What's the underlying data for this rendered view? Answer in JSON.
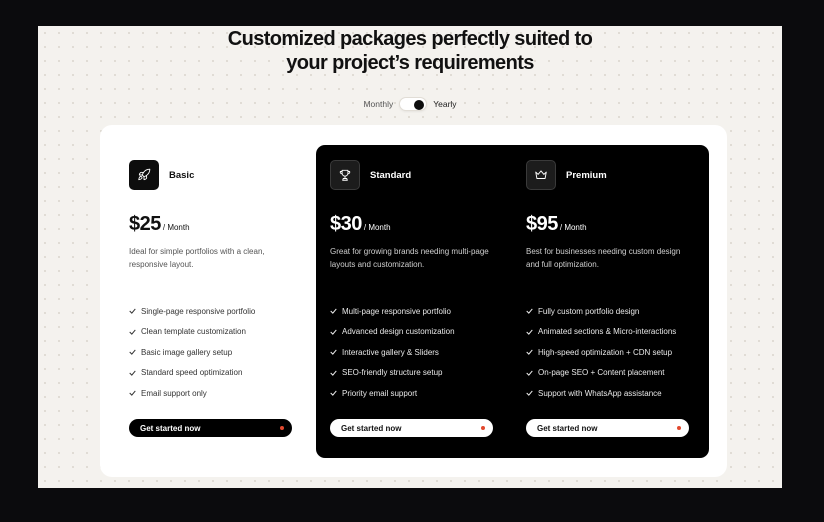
{
  "heading": {
    "line1": "Customized packages perfectly suited to",
    "line2": "your project’s requirements"
  },
  "billing_toggle": {
    "left_label": "Monthly",
    "right_label": "Yearly",
    "selected": "Yearly"
  },
  "plans": [
    {
      "name": "Basic",
      "icon": "rocket-icon",
      "price": "$25",
      "period": "/ Month",
      "description": "Ideal for simple portfolios with a clean, responsive layout.",
      "features": [
        "Single-page responsive portfolio",
        "Clean template customization",
        "Basic image gallery setup",
        "Standard speed optimization",
        "Email support only"
      ],
      "cta": "Get started now"
    },
    {
      "name": "Standard",
      "icon": "trophy-icon",
      "price": "$30",
      "period": "/ Month",
      "description": "Great for growing brands needing multi-page layouts and customization.",
      "features": [
        "Multi-page responsive portfolio",
        "Advanced design customization",
        "Interactive gallery & Sliders",
        "SEO-friendly structure setup",
        "Priority email support"
      ],
      "cta": "Get started now"
    },
    {
      "name": "Premium",
      "icon": "crown-icon",
      "price": "$95",
      "period": "/ Month",
      "description": "Best for businesses needing custom design and full optimization.",
      "features": [
        "Fully custom portfolio design",
        "Animated sections & Micro-interactions",
        "High-speed optimization + CDN setup",
        "On-page SEO + Content placement",
        "Support with WhatsApp assistance"
      ],
      "cta": "Get started now"
    }
  ],
  "colors": {
    "accent_dot": "#e2492f",
    "dark_card": "#000000",
    "page_background": "#f4f2ee"
  }
}
